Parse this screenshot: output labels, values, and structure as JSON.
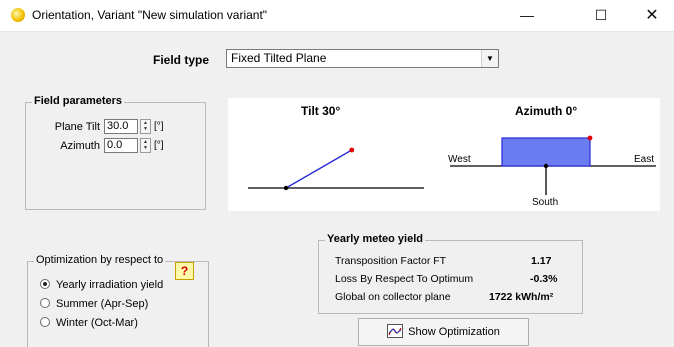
{
  "window": {
    "title": "Orientation, Variant \"New simulation variant\"",
    "minimize_glyph": "—",
    "maximize_glyph": "☐",
    "close_glyph": "✕"
  },
  "field_type": {
    "label": "Field type",
    "value": "Fixed Tilted Plane"
  },
  "field_parameters": {
    "title": "Field parameters",
    "plane_tilt": {
      "label": "Plane Tilt",
      "value": "30.0",
      "unit": "[°]"
    },
    "azimuth": {
      "label": "Azimuth",
      "value": "0.0",
      "unit": "[°]"
    }
  },
  "diagram": {
    "tilt_title": "Tilt 30°",
    "azimuth_title": "Azimuth 0°",
    "west_label": "West",
    "east_label": "East",
    "south_label": "South",
    "tilt_deg": 30,
    "azimuth_deg": 0,
    "colors": {
      "plane": "#2a2ad8",
      "plane_fill": "#6a7cf0",
      "marker": "#e00000",
      "ground": "#000000"
    }
  },
  "optimization": {
    "title": "Optimization by respect to",
    "options": [
      {
        "label": "Yearly irradiation yield",
        "selected": true
      },
      {
        "label": "Summer (Apr-Sep)",
        "selected": false
      },
      {
        "label": "Winter (Oct-Mar)",
        "selected": false
      }
    ],
    "help_label": "?"
  },
  "yearly_yield": {
    "title": "Yearly meteo yield",
    "rows": [
      {
        "label": "Transposition Factor FT",
        "value": "1.17"
      },
      {
        "label": "Loss By Respect To Optimum",
        "value": "-0.3%"
      },
      {
        "label": "Global on collector plane",
        "value": "1722 kWh/m²"
      }
    ]
  },
  "show_optimization": {
    "label": "Show Optimization",
    "icon": "chart-icon"
  }
}
